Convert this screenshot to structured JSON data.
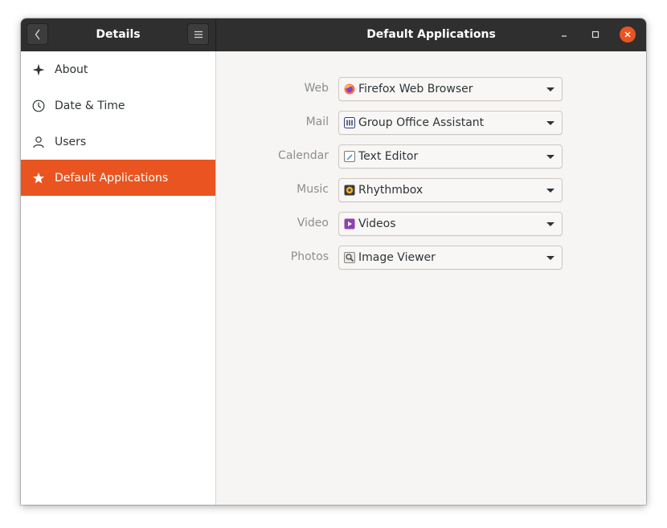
{
  "header": {
    "sidebar_title": "Details",
    "main_title": "Default Applications"
  },
  "sidebar": {
    "items": [
      {
        "label": "About",
        "icon": "sparkle-icon",
        "active": false
      },
      {
        "label": "Date & Time",
        "icon": "clock-icon",
        "active": false
      },
      {
        "label": "Users",
        "icon": "user-icon",
        "active": false
      },
      {
        "label": "Default Applications",
        "icon": "star-icon",
        "active": true
      }
    ]
  },
  "defaults": {
    "rows": [
      {
        "label": "Web",
        "value": "Firefox Web Browser",
        "icon": "firefox-icon"
      },
      {
        "label": "Mail",
        "value": "Group Office Assistant",
        "icon": "group-office-icon"
      },
      {
        "label": "Calendar",
        "value": "Text Editor",
        "icon": "text-editor-icon"
      },
      {
        "label": "Music",
        "value": "Rhythmbox",
        "icon": "rhythmbox-icon"
      },
      {
        "label": "Video",
        "value": "Videos",
        "icon": "videos-icon"
      },
      {
        "label": "Photos",
        "value": "Image Viewer",
        "icon": "image-viewer-icon"
      }
    ]
  },
  "colors": {
    "accent": "#e95420",
    "titlebar": "#2f2f2f",
    "content_bg": "#f6f5f4"
  }
}
